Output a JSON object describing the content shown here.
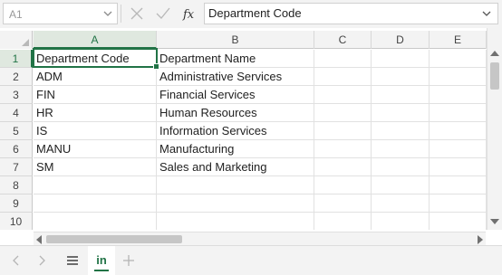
{
  "formula_bar": {
    "name_box": "A1",
    "formula": "Department Code"
  },
  "columns": [
    "A",
    "B",
    "C",
    "D",
    "E"
  ],
  "rows": [
    {
      "num": "1",
      "a": "Department Code",
      "b": "Department Name"
    },
    {
      "num": "2",
      "a": "ADM",
      "b": "Administrative Services"
    },
    {
      "num": "3",
      "a": "FIN",
      "b": "Financial Services"
    },
    {
      "num": "4",
      "a": "HR",
      "b": "Human Resources"
    },
    {
      "num": "5",
      "a": "IS",
      "b": "Information Services"
    },
    {
      "num": "6",
      "a": "MANU",
      "b": "Manufacturing"
    },
    {
      "num": "7",
      "a": "SM",
      "b": "Sales and Marketing"
    },
    {
      "num": "8",
      "a": "",
      "b": ""
    },
    {
      "num": "9",
      "a": "",
      "b": ""
    },
    {
      "num": "10",
      "a": "",
      "b": ""
    }
  ],
  "sheets": {
    "active": "in"
  },
  "colors": {
    "accent": "#217346",
    "header_bg": "#f3f3f3",
    "selected_header_bg": "#dfe8df"
  }
}
